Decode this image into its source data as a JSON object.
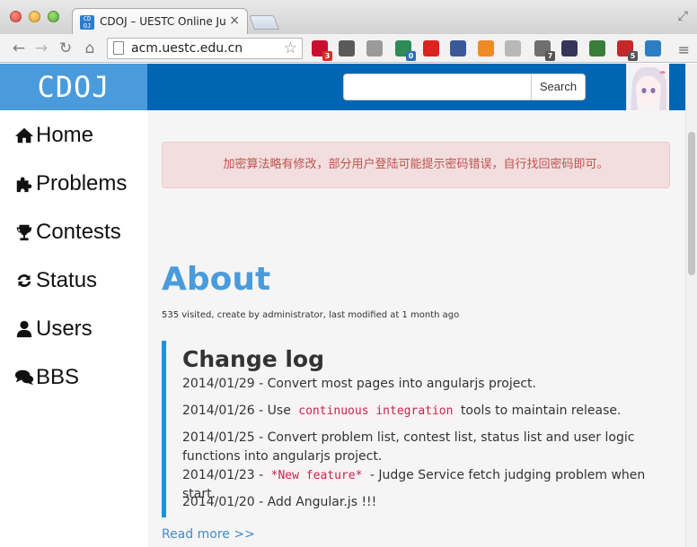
{
  "browser": {
    "tab_title": "CDOJ – UESTC Online Judge",
    "tab_favicon_text": "CD OJ",
    "url": "acm.uestc.edu.cn",
    "extensions": [
      {
        "name": "lastpass-extension-icon",
        "color": "#c8102e",
        "badge": "3",
        "badge_color": "red"
      },
      {
        "name": "flickr-extension-icon",
        "color": "#5a5a5a",
        "badge": ""
      },
      {
        "name": "proxy-extension-icon",
        "color": "#9a9a9a",
        "badge": ""
      },
      {
        "name": "html5-extension-icon",
        "color": "#2e8b57",
        "badge": "0",
        "badge_color": "blue"
      },
      {
        "name": "adblock-extension-icon",
        "color": "#d22",
        "badge": ""
      },
      {
        "name": "facebook-extension-icon",
        "color": "#3b5998",
        "badge": ""
      },
      {
        "name": "rss-extension-icon",
        "color": "#f08a24",
        "badge": ""
      },
      {
        "name": "bell-extension-icon",
        "color": "#b8b8b8",
        "badge": ""
      },
      {
        "name": "screenshot-extension-icon",
        "color": "#6f6f6f",
        "badge": "7"
      },
      {
        "name": "speedometer-extension-icon",
        "color": "#35355a",
        "badge": ""
      },
      {
        "name": "color-wheel-extension-icon",
        "color": "#3a7d3a",
        "badge": ""
      },
      {
        "name": "puzzle-extension-icon",
        "color": "#c62828",
        "badge": "5"
      },
      {
        "name": "circle-extension-icon",
        "color": "#2c7ec4",
        "badge": ""
      }
    ]
  },
  "site": {
    "brand": "CDOJ",
    "search_placeholder": "",
    "search_button": "Search"
  },
  "sidebar": {
    "items": [
      {
        "label": "Home",
        "icon": "home-icon"
      },
      {
        "label": "Problems",
        "icon": "puzzle-icon"
      },
      {
        "label": "Contests",
        "icon": "trophy-icon"
      },
      {
        "label": "Status",
        "icon": "refresh-icon"
      },
      {
        "label": "Users",
        "icon": "user-icon"
      },
      {
        "label": "BBS",
        "icon": "comments-icon"
      }
    ]
  },
  "main": {
    "alert": "加密算法略有修改，部分用户登陆可能提示密码错误，自行找回密码即可。",
    "title": "About",
    "meta": "535 visited, create by administrator, last modified at 1 month ago",
    "changelog_title": "Change log",
    "entries": [
      {
        "date": "2014/01/29",
        "sep": " - ",
        "pre": "Convert most pages into angularjs project.",
        "code": "",
        "post": ""
      },
      {
        "date": "2014/01/26",
        "sep": " - ",
        "pre": "Use ",
        "code": "continuous integration",
        "post": " tools to maintain release."
      },
      {
        "date": "2014/01/25",
        "sep": " - ",
        "pre": "Convert problem list, contest list, status list and user logic functions into angularjs project.",
        "code": "",
        "post": ""
      },
      {
        "date": "2014/01/23",
        "sep": " - ",
        "pre": "",
        "code": "*New feature*",
        "post": " - Judge Service fetch judging problem when start."
      },
      {
        "date": "2014/01/20",
        "sep": " - ",
        "pre": "Add Angular.js !!!",
        "code": "",
        "post": ""
      }
    ],
    "read_more": "Read more >>"
  },
  "colors": {
    "nav": "#0066b3",
    "brand_bg": "#4a9bdc",
    "title": "#4a9bdc",
    "alert_text": "#c0524d",
    "changelog_border": "#1a95dd",
    "link": "#428bca"
  }
}
